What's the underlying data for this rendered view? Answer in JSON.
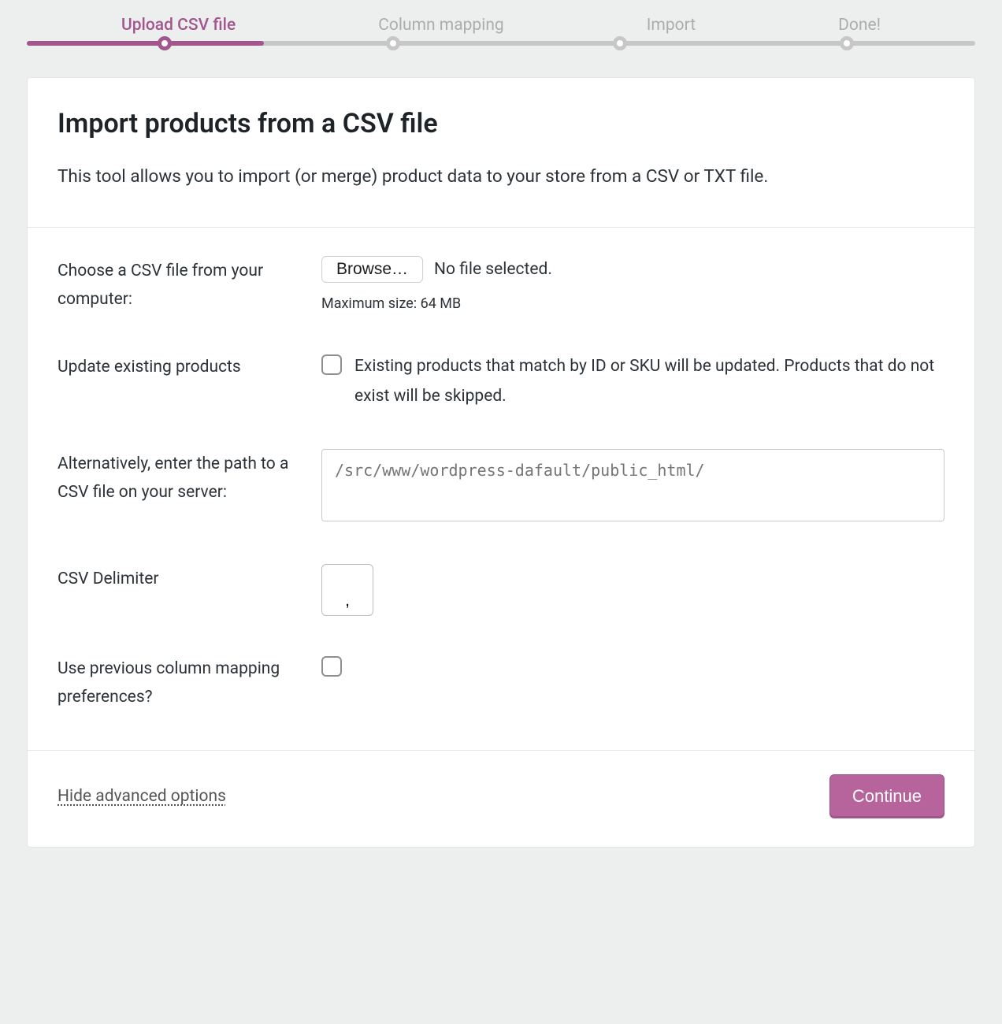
{
  "stepper": {
    "steps": [
      {
        "label": "Upload CSV file",
        "active": true
      },
      {
        "label": "Column mapping",
        "active": false
      },
      {
        "label": "Import",
        "active": false
      },
      {
        "label": "Done!",
        "active": false
      }
    ]
  },
  "header": {
    "title": "Import products from a CSV file",
    "description": "This tool allows you to import (or merge) product data to your store from a CSV or TXT file."
  },
  "form": {
    "choose_file": {
      "label": "Choose a CSV file from your computer:",
      "browse": "Browse…",
      "status": "No file selected.",
      "hint": "Maximum size: 64 MB"
    },
    "update_existing": {
      "label": "Update existing products",
      "description": "Existing products that match by ID or SKU will be updated. Products that do not exist will be skipped."
    },
    "server_path": {
      "label": "Alternatively, enter the path to a CSV file on your server:",
      "placeholder": "/src/www/wordpress-dafault/public_html/"
    },
    "delimiter": {
      "label": "CSV Delimiter",
      "value": ","
    },
    "prev_mapping": {
      "label": "Use previous column mapping preferences?"
    }
  },
  "footer": {
    "toggle_link": "Hide advanced options",
    "continue": "Continue"
  }
}
